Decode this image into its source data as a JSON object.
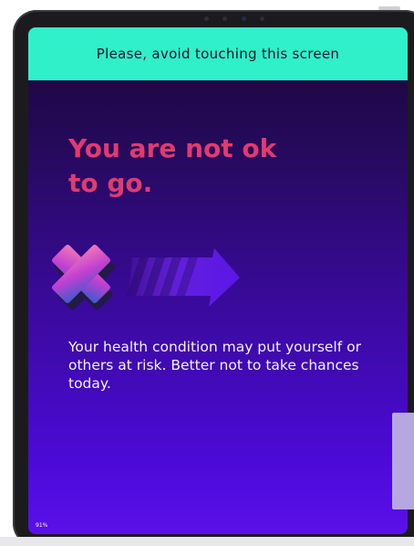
{
  "banner": {
    "text": "Please, avoid touching this screen"
  },
  "result": {
    "headline_line1": "You are not ok",
    "headline_line2": "to go.",
    "icon": "x-mark-arrow-icon",
    "message": "Your health condition may put yourself or others at risk. Better not to take chances today."
  },
  "status": {
    "battery": "91%"
  },
  "colors": {
    "banner_bg": "#2ff0c9",
    "headline": "#e23a6e",
    "screen_top": "#1a0634",
    "screen_bottom": "#5a10ea",
    "arrow": "#5a16e8"
  }
}
